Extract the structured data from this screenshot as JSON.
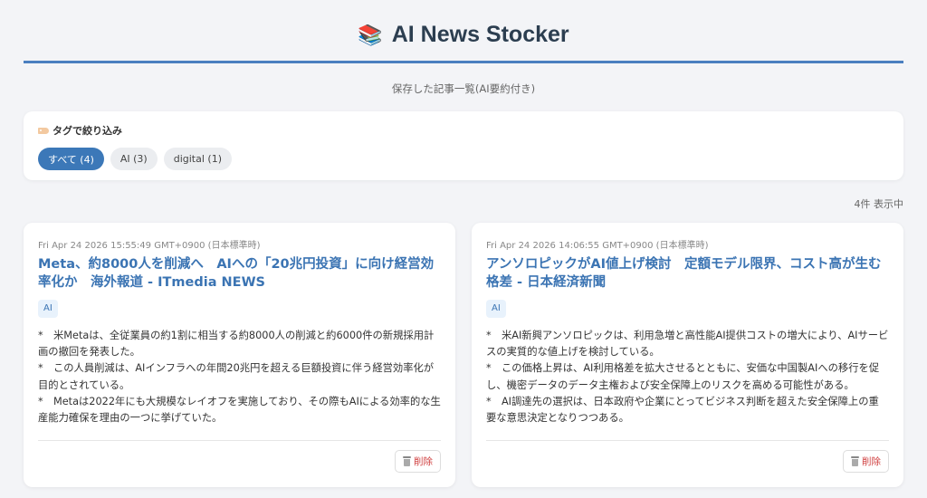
{
  "header": {
    "icon": "books-icon",
    "icon_glyph": "📚",
    "title": "AI News Stocker",
    "subtitle": "保存した記事一覧(AI要約付き)"
  },
  "filter": {
    "title": "タグで絞り込み",
    "icon": "tag-icon",
    "chips": [
      {
        "label": "すべて (4)",
        "active": true
      },
      {
        "label": "AI (3)",
        "active": false
      },
      {
        "label": "digital (1)",
        "active": false
      }
    ]
  },
  "count_text": "4件 表示中",
  "articles": [
    {
      "date": "Fri Apr 24 2026 15:55:49 GMT+0900 (日本標準時)",
      "title": "Meta、約8000人を削減へ　AIへの「20兆円投資」に向け経営効率化か　海外報道 - ITmedia NEWS",
      "tag": "AI",
      "summary": [
        "*　米Metaは、全従業員の約1割に相当する約8000人の削減と約6000件の新規採用計画の撤回を発表した。",
        "*　この人員削減は、AIインフラへの年間20兆円を超える巨額投資に伴う経営効率化が目的とされている。",
        "*　Metaは2022年にも大規模なレイオフを実施しており、その際もAIによる効率的な生産能力確保を理由の一つに挙げていた。"
      ],
      "delete_label": "削除"
    },
    {
      "date": "Fri Apr 24 2026 14:06:55 GMT+0900 (日本標準時)",
      "title": "アンソロピックがAI値上げ検討　定額モデル限界、コスト高が生む格差 - 日本経済新聞",
      "tag": "AI",
      "summary": [
        "*　米AI新興アンソロピックは、利用急増と高性能AI提供コストの増大により、AIサービスの実質的な値上げを検討している。",
        "*　この価格上昇は、AI利用格差を拡大させるとともに、安価な中国製AIへの移行を促し、機密データのデータ主権および安全保障上のリスクを高める可能性がある。",
        "*　AI調達先の選択は、日本政府や企業にとってビジネス判断を超えた安全保障上の重要な意思決定となりつつある。"
      ],
      "delete_label": "削除"
    }
  ],
  "colors": {
    "accent": "#3c78b8",
    "title_link": "#3b74b3",
    "delete": "#d04040",
    "background": "#f3f4f7"
  }
}
